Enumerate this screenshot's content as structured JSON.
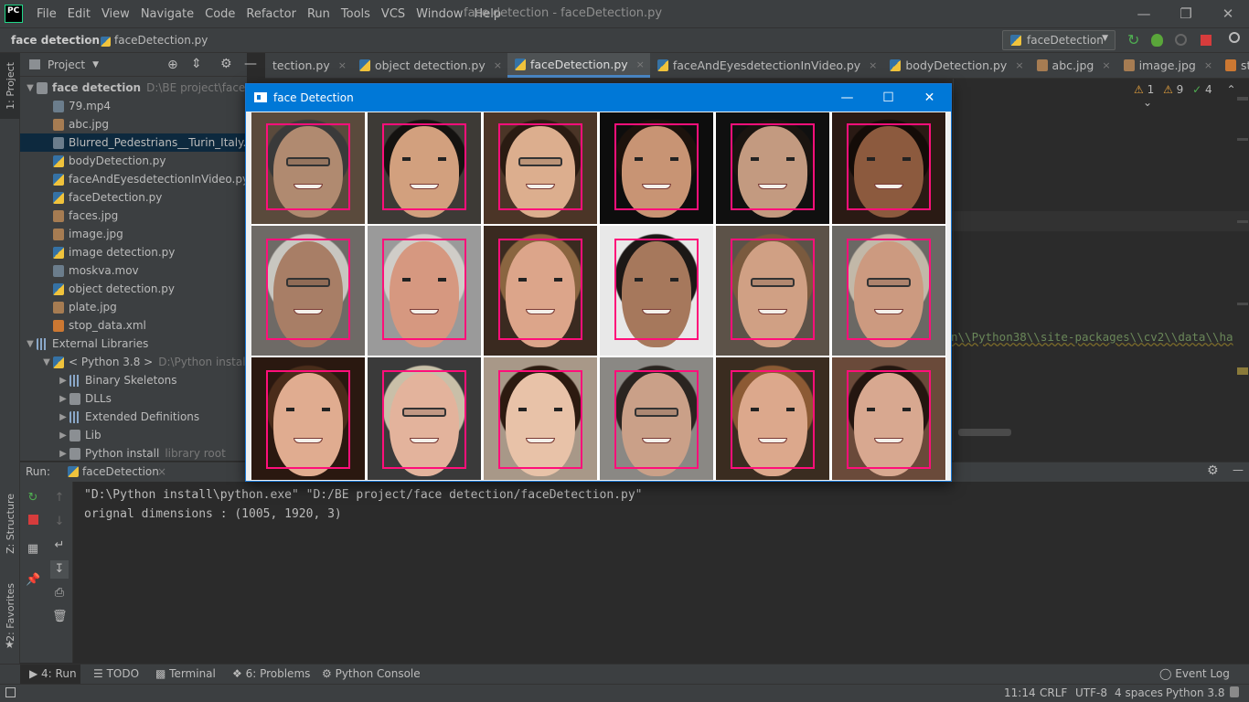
{
  "app": {
    "logo": "PC",
    "window_title": "face detection - faceDetection.py"
  },
  "menu": [
    "File",
    "Edit",
    "View",
    "Navigate",
    "Code",
    "Refactor",
    "Run",
    "Tools",
    "VCS",
    "Window",
    "Help"
  ],
  "breadcrumb": {
    "project": "face detection",
    "file": "faceDetection.py"
  },
  "run_config": "faceDetection",
  "project_panel": {
    "title": "Project",
    "side_label": "1: Project",
    "tree": [
      {
        "depth": 0,
        "arrow": "▼",
        "icon": "folder",
        "label": "face detection",
        "meta": "D:\\BE project\\face detection"
      },
      {
        "depth": 1,
        "icon": "mov",
        "label": "79.mp4"
      },
      {
        "depth": 1,
        "icon": "img",
        "label": "abc.jpg"
      },
      {
        "depth": 1,
        "icon": "mov",
        "label": "Blurred_Pedestrians__Turin_Italy.mov",
        "selected": true
      },
      {
        "depth": 1,
        "icon": "py",
        "label": "bodyDetection.py"
      },
      {
        "depth": 1,
        "icon": "py",
        "label": "faceAndEyesdetectionInVideo.py"
      },
      {
        "depth": 1,
        "icon": "py",
        "label": "faceDetection.py"
      },
      {
        "depth": 1,
        "icon": "img",
        "label": "faces.jpg"
      },
      {
        "depth": 1,
        "icon": "img",
        "label": "image.jpg"
      },
      {
        "depth": 1,
        "icon": "py",
        "label": "image detection.py"
      },
      {
        "depth": 1,
        "icon": "mov",
        "label": "moskva.mov"
      },
      {
        "depth": 1,
        "icon": "py",
        "label": "object detection.py"
      },
      {
        "depth": 1,
        "icon": "img",
        "label": "plate.jpg"
      },
      {
        "depth": 1,
        "icon": "xml",
        "label": "stop_data.xml"
      },
      {
        "depth": 0,
        "arrow": "▼",
        "icon": "lib",
        "label": "External Libraries"
      },
      {
        "depth": 1,
        "arrow": "▼",
        "icon": "py",
        "label": "< Python 3.8 >",
        "meta": "D:\\Python install\\python.exe"
      },
      {
        "depth": 2,
        "arrow": "▶",
        "icon": "lib",
        "label": "Binary Skeletons"
      },
      {
        "depth": 2,
        "arrow": "▶",
        "icon": "folder",
        "label": "DLLs"
      },
      {
        "depth": 2,
        "arrow": "▶",
        "icon": "lib",
        "label": "Extended Definitions"
      },
      {
        "depth": 2,
        "arrow": "▶",
        "icon": "folder",
        "label": "Lib"
      },
      {
        "depth": 2,
        "arrow": "▶",
        "icon": "folder",
        "label": "Python install",
        "meta": "library root"
      }
    ]
  },
  "tabs": [
    {
      "label": "tection.py",
      "close": "×"
    },
    {
      "label": "object detection.py",
      "close": "×"
    },
    {
      "label": "faceDetection.py",
      "close": "×",
      "active": true
    },
    {
      "label": "faceAndEyesdetectionInVideo.py",
      "close": "×"
    },
    {
      "label": "bodyDetection.py",
      "close": "×"
    },
    {
      "label": "abc.jpg",
      "close": "×"
    },
    {
      "label": "image.jpg",
      "close": "×"
    },
    {
      "label": "stop_data.xml",
      "close": "×"
    }
  ],
  "inspections": {
    "warnings": "1",
    "weak": "9",
    "ok": "4"
  },
  "code_fragment": "n\\\\Python38\\\\site-packages\\\\cv2\\\\data\\\\ha",
  "run_panel": {
    "label": "Run:",
    "tab": "faceDetection",
    "close": "×"
  },
  "console": [
    "\"D:\\Python install\\python.exe\" \"D:/BE project/face detection/faceDetection.py\"",
    "orignal dimensions : (1005, 1920, 3)"
  ],
  "side_labels": {
    "structure": "Z: Structure",
    "favorites": "2: Favorites"
  },
  "bottom_tabs": [
    {
      "label": "4: Run"
    },
    {
      "label": "TODO"
    },
    {
      "label": "Terminal"
    },
    {
      "label": "6: Problems"
    },
    {
      "label": "Python Console"
    }
  ],
  "event_log": "Event Log",
  "status": {
    "position": "11:14",
    "line_sep": "CRLF",
    "encoding": "UTF-8",
    "indent": "4 spaces",
    "interpreter": "Python 3.8"
  },
  "cv_window": {
    "title": "face Detection"
  },
  "faces": [
    {
      "bg": "#5a4a3c",
      "hair": "#3a3a3a",
      "skin": "#b08a70",
      "glasses": true
    },
    {
      "bg": "#3d3a36",
      "hair": "#141210",
      "skin": "#d2a07e"
    },
    {
      "bg": "#4b3527",
      "hair": "#2a1b12",
      "skin": "#dcae8e",
      "glasses": true
    },
    {
      "bg": "#0d0d0d",
      "hair": "#1c120c",
      "skin": "#c89474"
    },
    {
      "bg": "#101010",
      "hair": "#1a1410",
      "skin": "#c39a80"
    },
    {
      "bg": "#2a1a14",
      "hair": "#140c08",
      "skin": "#8c5a3e"
    },
    {
      "bg": "#6e6a66",
      "hair": "#c8c6c0",
      "skin": "#a87e66",
      "glasses": true
    },
    {
      "bg": "#9a9a9a",
      "hair": "#d0cdc8",
      "skin": "#d69880"
    },
    {
      "bg": "#3a2a20",
      "hair": "#8a6540",
      "skin": "#dca58a"
    },
    {
      "bg": "#e8e8e8",
      "hair": "#1c1816",
      "skin": "#a6785c"
    },
    {
      "bg": "#5c5248",
      "hair": "#7a5a3e",
      "skin": "#d0a084",
      "glasses": true
    },
    {
      "bg": "#6a6864",
      "hair": "#c2b8a8",
      "skin": "#cc9a80",
      "glasses": true
    },
    {
      "bg": "#2a1810",
      "hair": "#4a2c1a",
      "skin": "#e0ac90"
    },
    {
      "bg": "#3a3a3a",
      "hair": "#c9bfa8",
      "skin": "#e3b39c",
      "glasses": true
    },
    {
      "bg": "#a89888",
      "hair": "#2c1a10",
      "skin": "#e8c2a8"
    },
    {
      "bg": "#8a8884",
      "hair": "#2a2420",
      "skin": "#caa088",
      "glasses": true
    },
    {
      "bg": "#3a2c20",
      "hair": "#8c5a34",
      "skin": "#dca88c"
    },
    {
      "bg": "#6a4a3a",
      "hair": "#241610",
      "skin": "#d8a890"
    }
  ]
}
